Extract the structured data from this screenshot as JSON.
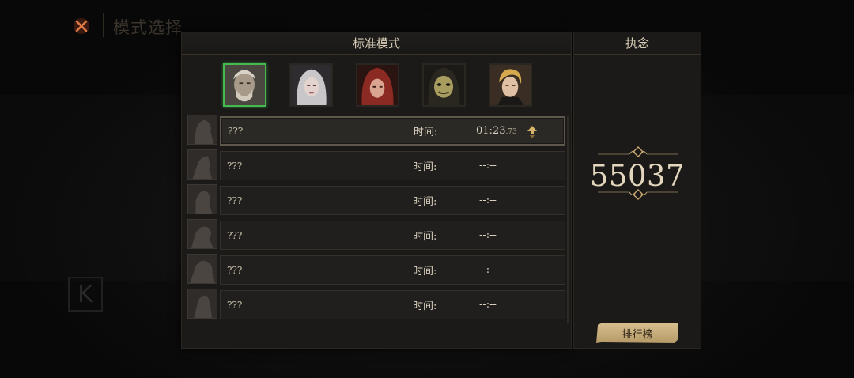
{
  "header": {
    "title": "模式选择",
    "close_icon": "close-x-icon",
    "accent": "#d9603a"
  },
  "panel": {
    "title": "标准模式",
    "portraits": [
      {
        "name": "old-man-portrait",
        "selected": true
      },
      {
        "name": "white-haired-woman-portrait",
        "selected": false
      },
      {
        "name": "red-hood-portrait",
        "selected": false
      },
      {
        "name": "masked-portrait",
        "selected": false
      },
      {
        "name": "blonde-man-portrait",
        "selected": false
      }
    ],
    "rows": [
      {
        "name": "???",
        "time_label": "时间:",
        "time": "01:23",
        "time_ms": ".73",
        "highlight": true
      },
      {
        "name": "???",
        "time_label": "时间:",
        "time": "--:--",
        "time_ms": ""
      },
      {
        "name": "???",
        "time_label": "时间:",
        "time": "--:--",
        "time_ms": ""
      },
      {
        "name": "???",
        "time_label": "时间:",
        "time": "--:--",
        "time_ms": ""
      },
      {
        "name": "???",
        "time_label": "时间:",
        "time": "--:--",
        "time_ms": ""
      },
      {
        "name": "???",
        "time_label": "时间:",
        "time": "--:--",
        "time_ms": ""
      }
    ]
  },
  "side": {
    "title": "执念",
    "score": "55037",
    "rank_button": "排行榜"
  },
  "colors": {
    "selected_border": "#45b94e",
    "gold": "#c8a971"
  }
}
